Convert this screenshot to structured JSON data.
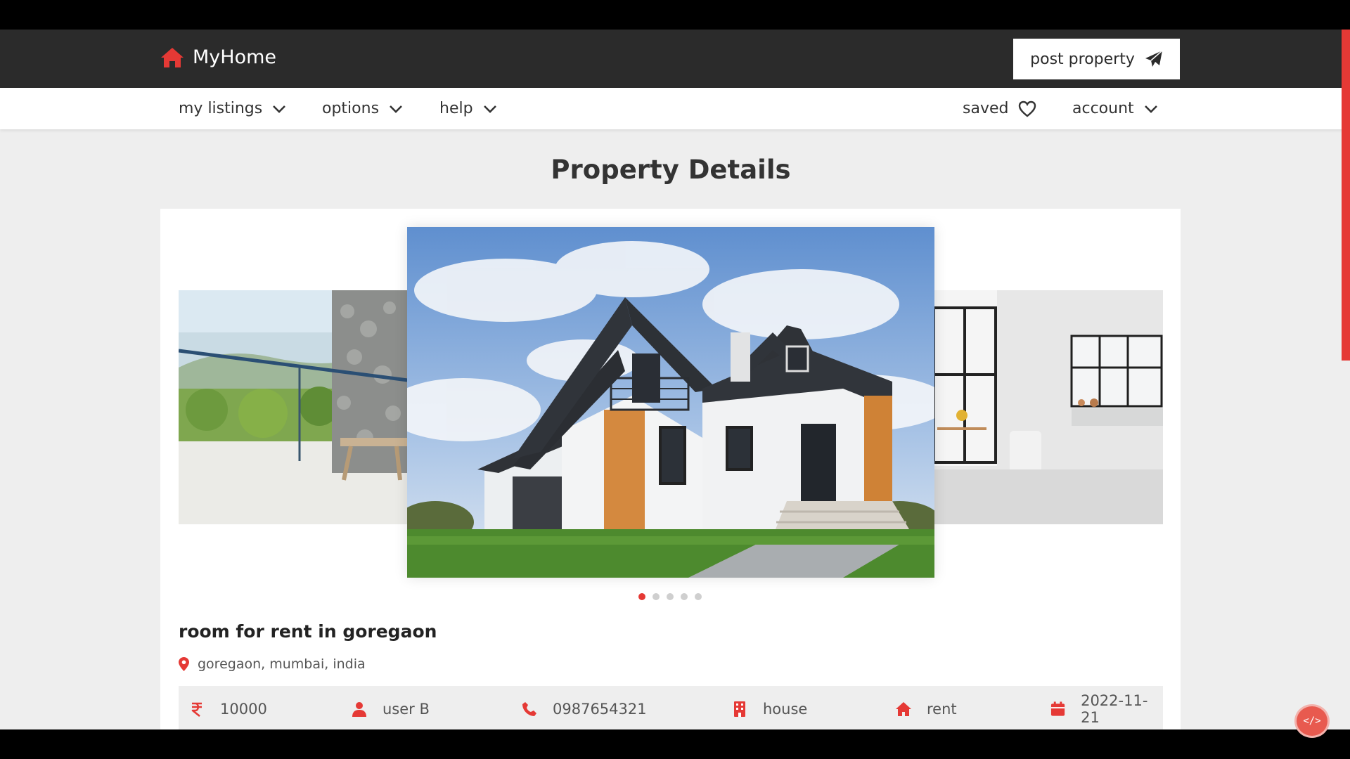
{
  "app": {
    "name": "MyHome"
  },
  "header": {
    "post_property_label": "post property"
  },
  "nav": {
    "my_listings": "my listings",
    "options": "options",
    "help": "help",
    "saved": "saved",
    "account": "account"
  },
  "page": {
    "title": "Property Details"
  },
  "carousel": {
    "slide_count": 5,
    "active_index": 0
  },
  "listing": {
    "title": "room for rent in goregaon",
    "location": "goregaon, mumbai, india",
    "price": "10000",
    "owner": "user B",
    "phone": "0987654321",
    "property_type": "house",
    "listing_type": "rent",
    "date": "2022-11-21"
  },
  "colors": {
    "accent": "#e53935",
    "topbar": "#2b2b2b",
    "page_bg": "#eeeeee"
  },
  "icons": {
    "logo": "home-icon",
    "post": "paper-plane-icon",
    "dropdown": "chevron-down-icon",
    "saved": "heart-icon",
    "location": "map-pin-icon",
    "price": "rupee-icon",
    "owner": "user-icon",
    "phone": "phone-icon",
    "type": "building-icon",
    "listing_type": "home-icon",
    "date": "calendar-icon"
  }
}
